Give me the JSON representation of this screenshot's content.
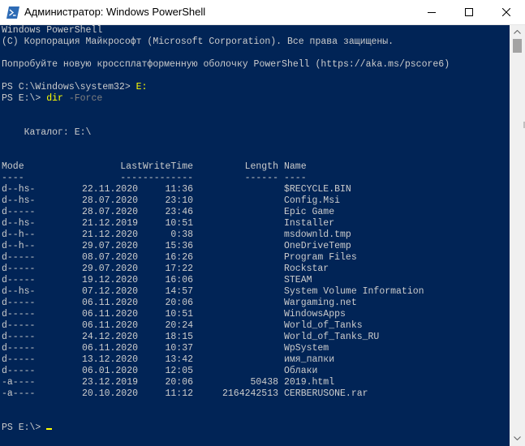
{
  "window": {
    "title": "Администратор: Windows PowerShell",
    "minimize_icon": "minimize-icon",
    "maximize_icon": "maximize-icon",
    "close_icon": "close-icon",
    "app_icon": "powershell-icon",
    "background_color": "#012456",
    "text_color": "#cccccc",
    "highlight_color": "#ffff00"
  },
  "console": {
    "banner_line1": "Windows PowerShell",
    "banner_line2": "(C) Корпорация Майкрософт (Microsoft Corporation). Все права защищены.",
    "banner_line3": "Попробуйте новую кроссплатформенную оболочку PowerShell (https://aka.ms/pscore6)",
    "prompt1": "PS C:\\Windows\\system32> ",
    "command1": "E:",
    "prompt2": "PS E:\\> ",
    "command2_cmd": "dir",
    "command2_arg": " -Force",
    "directory_label": "    Каталог: E:\\",
    "header_mode": "Mode",
    "header_lastwritetime": "LastWriteTime",
    "header_length": "Length",
    "header_name": "Name",
    "sep_mode": "----",
    "sep_lastwritetime": "-------------",
    "sep_length": "------",
    "sep_name": "----",
    "entries": [
      {
        "mode": "d--hs-",
        "date": "22.11.2020",
        "time": "11:36",
        "length": "",
        "name": "$RECYCLE.BIN"
      },
      {
        "mode": "d--hs-",
        "date": "28.07.2020",
        "time": "23:10",
        "length": "",
        "name": "Config.Msi"
      },
      {
        "mode": "d-----",
        "date": "28.07.2020",
        "time": "23:46",
        "length": "",
        "name": "Epic Game"
      },
      {
        "mode": "d--hs-",
        "date": "21.12.2019",
        "time": "10:51",
        "length": "",
        "name": "Installer"
      },
      {
        "mode": "d--h--",
        "date": "21.12.2020",
        "time": "0:38",
        "length": "",
        "name": "msdownld.tmp"
      },
      {
        "mode": "d--h--",
        "date": "29.07.2020",
        "time": "15:36",
        "length": "",
        "name": "OneDriveTemp"
      },
      {
        "mode": "d-----",
        "date": "08.07.2020",
        "time": "16:26",
        "length": "",
        "name": "Program Files"
      },
      {
        "mode": "d-----",
        "date": "29.07.2020",
        "time": "17:22",
        "length": "",
        "name": "Rockstar"
      },
      {
        "mode": "d-----",
        "date": "19.12.2020",
        "time": "16:06",
        "length": "",
        "name": "STEAM"
      },
      {
        "mode": "d--hs-",
        "date": "07.12.2020",
        "time": "14:57",
        "length": "",
        "name": "System Volume Information"
      },
      {
        "mode": "d-----",
        "date": "06.11.2020",
        "time": "20:06",
        "length": "",
        "name": "Wargaming.net"
      },
      {
        "mode": "d-----",
        "date": "06.11.2020",
        "time": "10:51",
        "length": "",
        "name": "WindowsApps"
      },
      {
        "mode": "d-----",
        "date": "06.11.2020",
        "time": "20:24",
        "length": "",
        "name": "World_of_Tanks"
      },
      {
        "mode": "d-----",
        "date": "24.12.2020",
        "time": "18:15",
        "length": "",
        "name": "World_of_Tanks_RU"
      },
      {
        "mode": "d-----",
        "date": "06.11.2020",
        "time": "10:37",
        "length": "",
        "name": "WpSystem"
      },
      {
        "mode": "d-----",
        "date": "13.12.2020",
        "time": "13:42",
        "length": "",
        "name": "имя_папки"
      },
      {
        "mode": "d-----",
        "date": "06.01.2020",
        "time": "12:05",
        "length": "",
        "name": "Облаки"
      },
      {
        "mode": "-a----",
        "date": "23.12.2019",
        "time": "20:06",
        "length": "50438",
        "name": "2019.html"
      },
      {
        "mode": "-a----",
        "date": "20.10.2020",
        "time": "11:12",
        "length": "2164242513",
        "name": "CERBERUSONE.rar"
      }
    ],
    "final_prompt": "PS E:\\> "
  },
  "scrollbar": {
    "up_icon": "scroll-up-arrow-icon",
    "down_icon": "scroll-down-arrow-icon"
  }
}
